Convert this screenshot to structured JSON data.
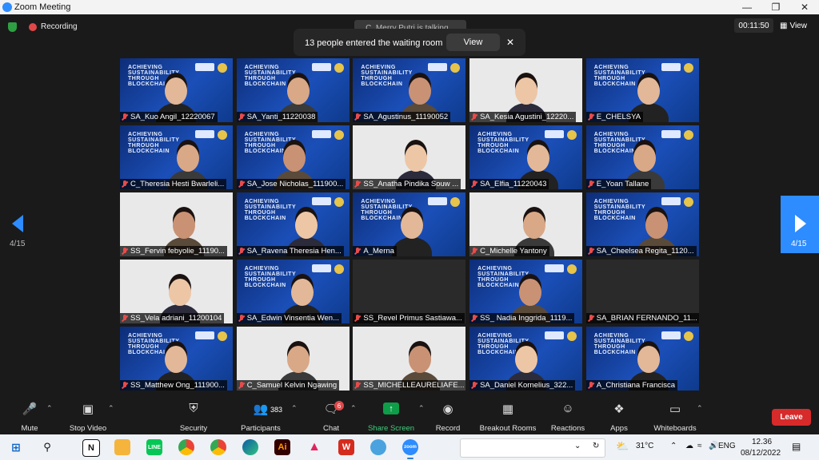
{
  "window": {
    "title": "Zoom Meeting"
  },
  "status": {
    "recording": "Recording",
    "timer": "00:11:50",
    "view": "View",
    "talking": "C_Merry Putri is talking..."
  },
  "notice": {
    "text": "13 people entered the waiting room",
    "button": "View"
  },
  "banner": {
    "line1": "ACHIEVING",
    "line2": "SUSTAINABILITY",
    "line3": "THROUGH",
    "line4": "BLOCKCHAIN"
  },
  "page": {
    "current": "4/15"
  },
  "participants": [
    {
      "name": "SA_Kuo Angil_12220067",
      "bg": "banner"
    },
    {
      "name": "SA_Yanti_11220038",
      "bg": "banner"
    },
    {
      "name": "SA_Agustinus_11190052",
      "bg": "banner"
    },
    {
      "name": "SA_Kesia Agustini_12220...",
      "bg": "light"
    },
    {
      "name": "E_CHELSYA",
      "bg": "banner"
    },
    {
      "name": "C_Theresia Hesti Bwarleli...",
      "bg": "banner"
    },
    {
      "name": "SA_Jose Nicholas_111900...",
      "bg": "banner"
    },
    {
      "name": "SS_Anatha Pindika Souw ...",
      "bg": "light"
    },
    {
      "name": "SA_Elfia_11220043",
      "bg": "banner"
    },
    {
      "name": "E_Yoan Tallane",
      "bg": "banner"
    },
    {
      "name": "SS_Fervin febyolie_11190...",
      "bg": "light"
    },
    {
      "name": "SA_Ravena Theresia Hen...",
      "bg": "banner"
    },
    {
      "name": "A_Merna",
      "bg": "banner"
    },
    {
      "name": "C_Michelle Yantony",
      "bg": "light"
    },
    {
      "name": "SA_Cheelsea Regita_1120...",
      "bg": "banner"
    },
    {
      "name": "SS_Vela adriani_11200104",
      "bg": "light"
    },
    {
      "name": "SA_Edwin Vinsentia Wen...",
      "bg": "banner"
    },
    {
      "name": "SS_Revel Primus Sastiawa...",
      "bg": "plain"
    },
    {
      "name": "SS_ Nadia Inggrida_1119...",
      "bg": "banner"
    },
    {
      "name": "SA_BRIAN FERNANDO_11...",
      "bg": "plain"
    },
    {
      "name": "SS_Matthew Ong_111900...",
      "bg": "banner"
    },
    {
      "name": "C_Samuel Kelvin Ngawing",
      "bg": "light"
    },
    {
      "name": "SS_MICHELLEAURELIAFE...",
      "bg": "light"
    },
    {
      "name": "SA_Daniel Kornelius_322...",
      "bg": "banner"
    },
    {
      "name": "A_Christiana Francisca",
      "bg": "banner"
    }
  ],
  "toolbar": {
    "mute": "Mute",
    "stop_video": "Stop Video",
    "security": "Security",
    "participants": "Participants",
    "participants_count": "383",
    "chat": "Chat",
    "chat_badge": "6",
    "share": "Share Screen",
    "record": "Record",
    "breakout": "Breakout Rooms",
    "reactions": "Reactions",
    "apps": "Apps",
    "whiteboards": "Whiteboards",
    "leave": "Leave"
  },
  "taskbar": {
    "weather": "31°C",
    "lang": "ENG",
    "time": "12.36",
    "date": "08/12/2022",
    "apps": [
      "N",
      "Ai"
    ]
  },
  "colors": {
    "zoom_blue": "#2d8cff",
    "leave_red": "#d72a2a",
    "share_green": "#0e9d48",
    "muted_red": "#e84b4b"
  }
}
